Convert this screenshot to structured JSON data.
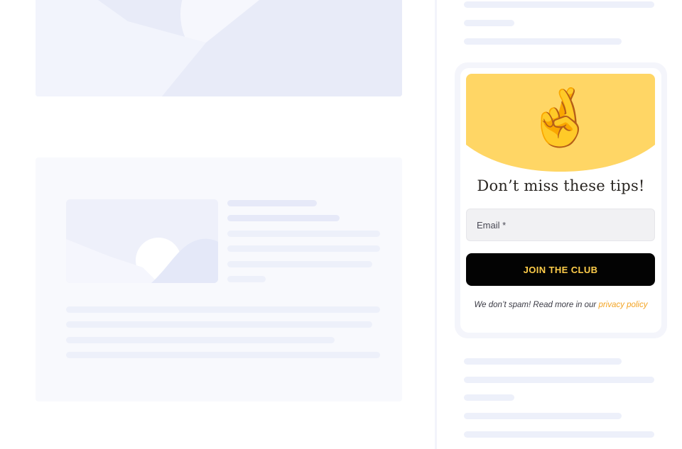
{
  "signup_widget": {
    "emoji": "🤞",
    "headline": "Don’t miss these tips!",
    "email_placeholder": "Email *",
    "cta_label": "JOIN THE CLUB",
    "note_prefix": "We don’t spam! Read more in our ",
    "note_link": "privacy policy"
  },
  "colors": {
    "banner": "#ffd665",
    "cta_bg": "#030303",
    "cta_text": "#ffcd4a",
    "link": "#f3a321",
    "skeleton": "#edf0fa"
  }
}
